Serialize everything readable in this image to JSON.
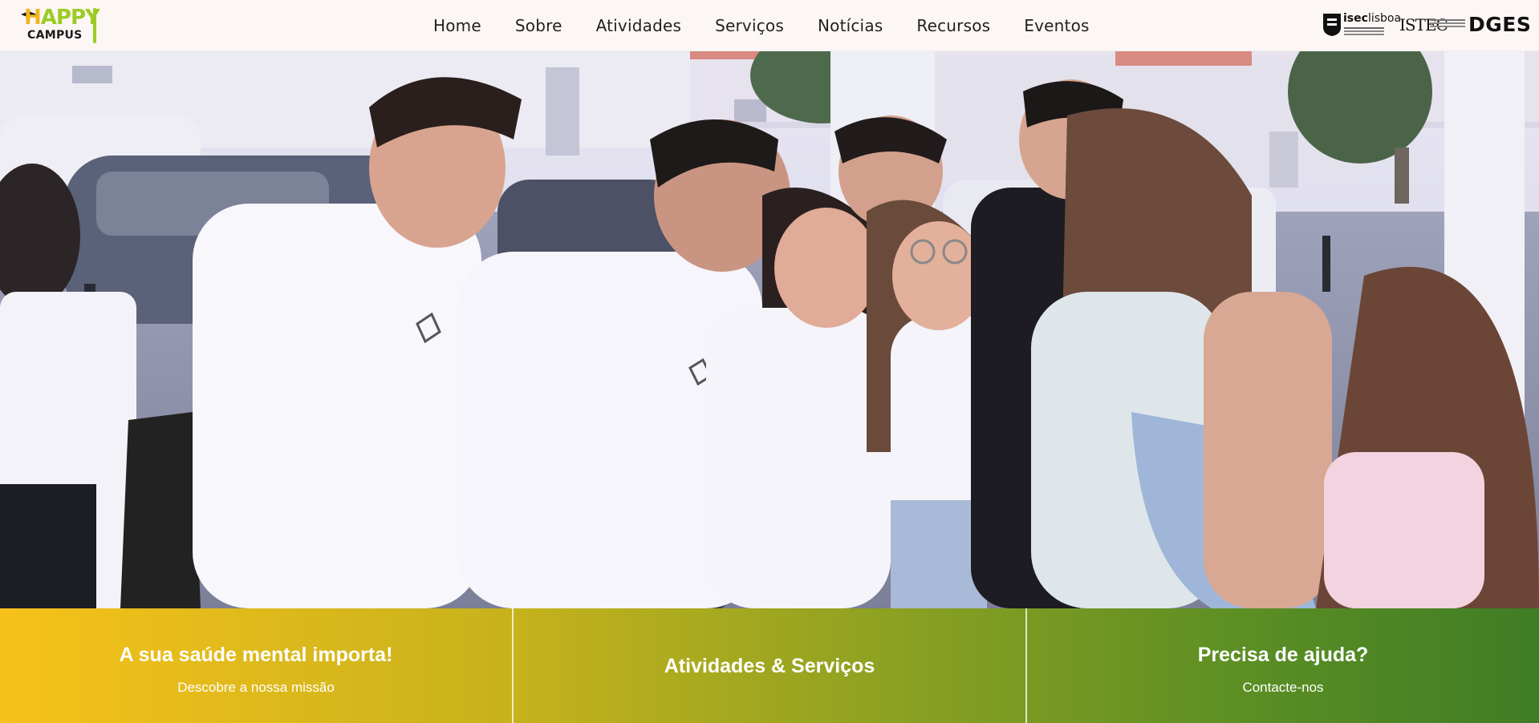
{
  "brand": {
    "logo_line1": "HAPPY",
    "logo_line2": "CAMPUS"
  },
  "nav": {
    "items": [
      {
        "label": "Home"
      },
      {
        "label": "Sobre"
      },
      {
        "label": "Atividades"
      },
      {
        "label": "Serviços"
      },
      {
        "label": "Notícias"
      },
      {
        "label": "Recursos"
      },
      {
        "label": "Eventos"
      }
    ]
  },
  "partners": {
    "isec_bold": "isec",
    "isec_light": "lisboa",
    "istec": "ISTEC",
    "dges": "DGES"
  },
  "hero": {
    "image": "photo of smiling students in white t-shirts at an outdoor campus event"
  },
  "tiles": [
    {
      "title": "A sua saúde mental importa!",
      "subtitle": "Descobre a nossa missão"
    },
    {
      "title": "Atividades & Serviços"
    },
    {
      "title": "Precisa de ajuda?",
      "subtitle": "Contacte-nos"
    }
  ],
  "colors": {
    "tile_gradient_start": "#f7c11a",
    "tile_gradient_end": "#3f7d25",
    "logo_green": "#9ccc24",
    "logo_yellow": "#f2b51c"
  }
}
